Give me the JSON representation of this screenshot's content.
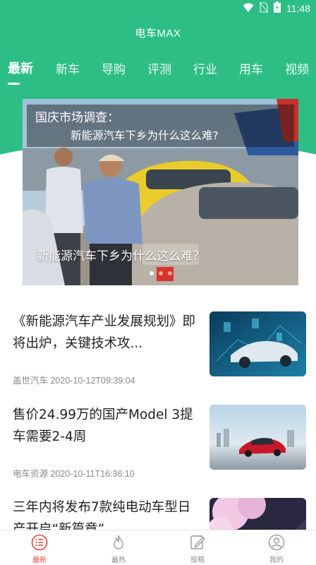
{
  "status_bar": {
    "time": "11:48",
    "icons": [
      "wifi-icon",
      "no-sim-icon",
      "battery-icon"
    ]
  },
  "app": {
    "title": "电车MAX",
    "brand_color": "#2dbe86",
    "accent_color": "#e8463f"
  },
  "tabs": [
    {
      "label": "最新",
      "active": true
    },
    {
      "label": "新车",
      "active": false
    },
    {
      "label": "导购",
      "active": false
    },
    {
      "label": "评测",
      "active": false
    },
    {
      "label": "行业",
      "active": false
    },
    {
      "label": "用车",
      "active": false
    },
    {
      "label": "视频",
      "active": false
    }
  ],
  "banner": {
    "headline_line1": "国庆市场调查：",
    "headline_line2": "新能源汽车下乡为什么这么难?",
    "caption": "新能源汽车下乡为什么这么难？",
    "slide_count": 3,
    "active_slide": 1
  },
  "news": [
    {
      "title": "《新能源汽车产业发展规划》即将出炉，关键技术攻...",
      "source": "盖世汽车",
      "time": "2020-10-12T09:39:04",
      "thumb_icon": "tech-car-thumbnail"
    },
    {
      "title": "售价24.99万的国产Model 3提车需要2-4周",
      "source": "电车资源",
      "time": "2020-10-11T16:36:10",
      "thumb_icon": "red-car-thumbnail"
    },
    {
      "title": "三年内将发布7款纯电动车型日产开启“新篇章”",
      "source": "",
      "time": "",
      "thumb_icon": "sakura-road-thumbnail"
    }
  ],
  "bottom_nav": [
    {
      "label": "最新",
      "icon": "list-icon",
      "active": true
    },
    {
      "label": "最热",
      "icon": "flame-icon",
      "active": false
    },
    {
      "label": "投稿",
      "icon": "edit-icon",
      "active": false
    },
    {
      "label": "我的",
      "icon": "user-icon",
      "active": false
    }
  ]
}
